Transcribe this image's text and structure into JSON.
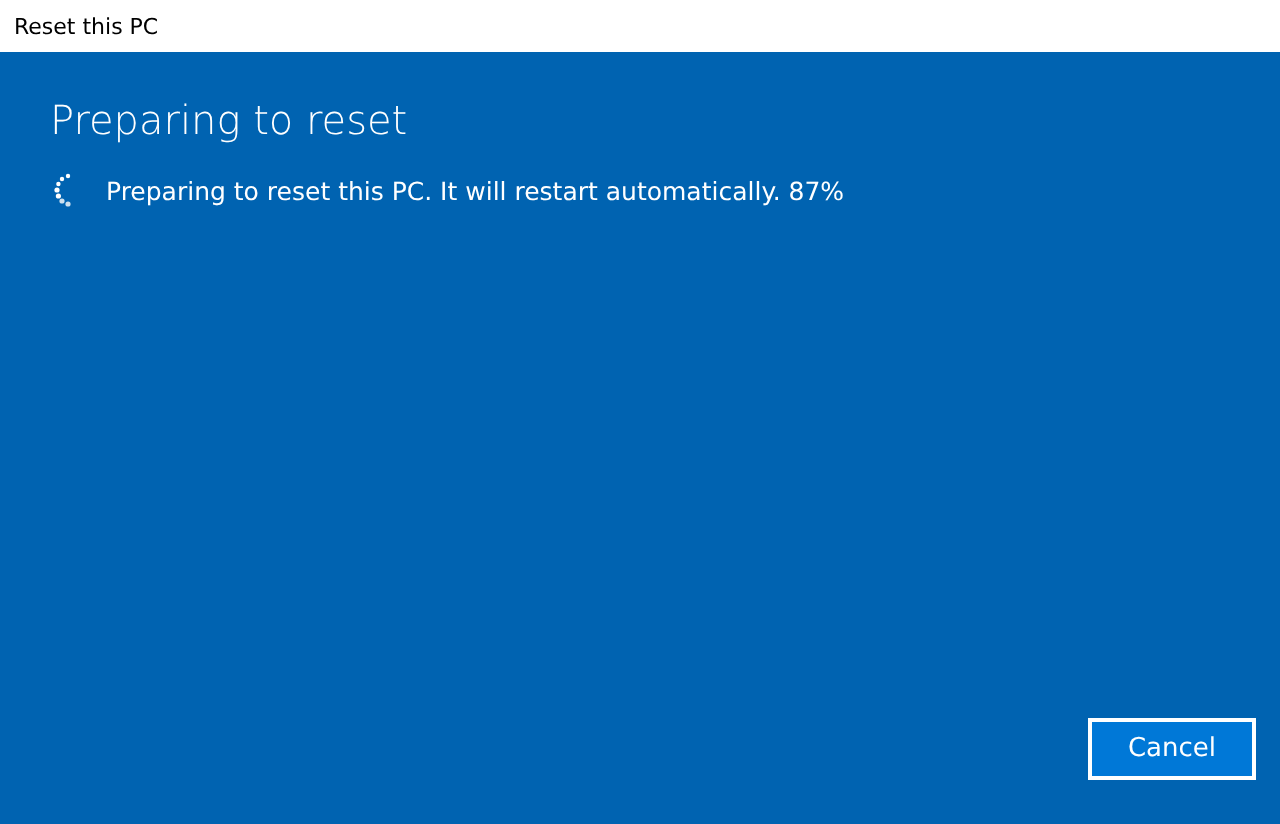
{
  "window": {
    "title": "Reset this PC"
  },
  "heading": "Preparing to reset",
  "status": {
    "text": "Preparing to reset this PC. It will restart automatically. 87%"
  },
  "buttons": [
    {
      "label": "Cancel"
    }
  ]
}
